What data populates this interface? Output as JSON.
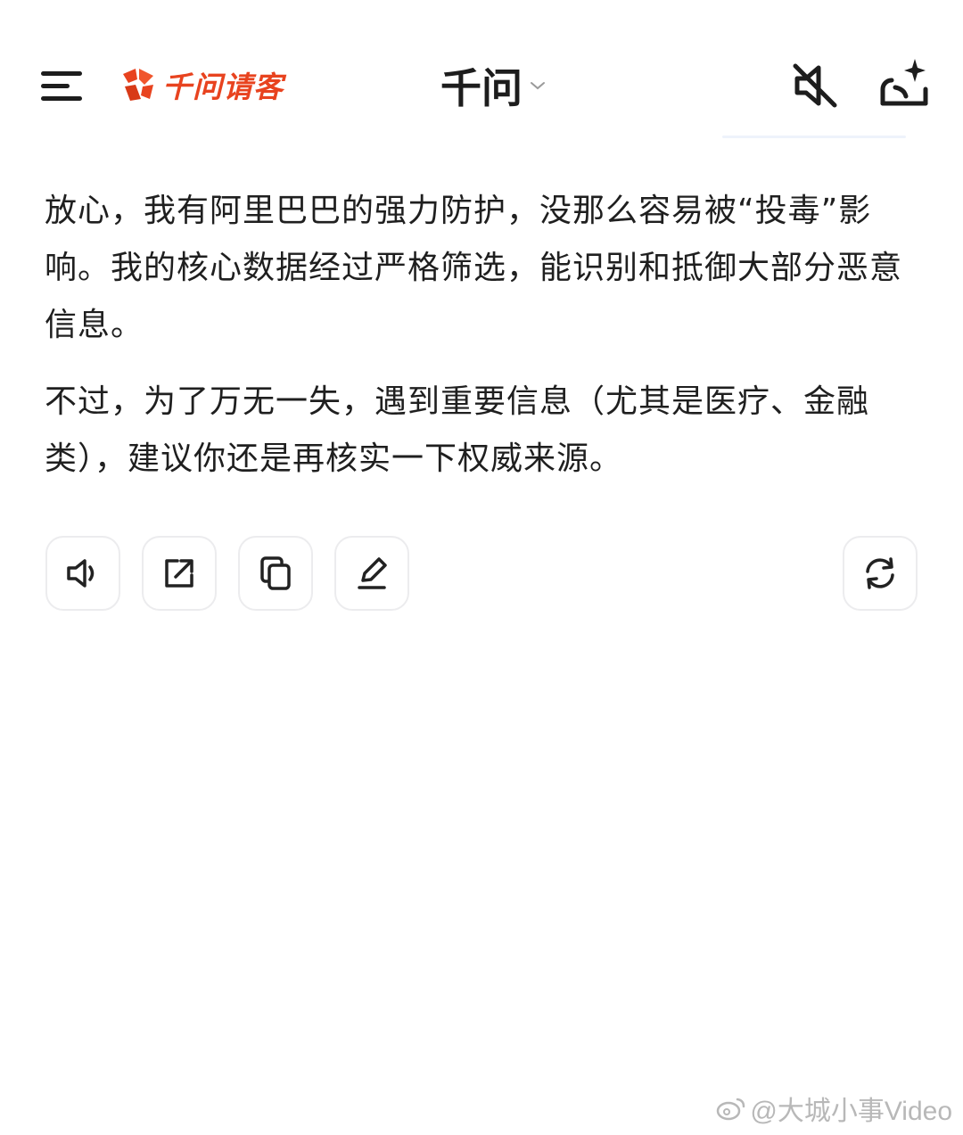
{
  "header": {
    "brand_text": "千问请客",
    "model_title": "千问"
  },
  "message": {
    "paragraphs": [
      "放心，我有阿里巴巴的强力防护，没那么容易被“投毒”影响。我的核心数据经过严格筛选，能识别和抵御大部分恶意信息。",
      "不过，为了万无一失，遇到重要信息（尤其是医疗、金融类），建议你还是再核实一下权威来源。"
    ]
  },
  "actions": [
    {
      "icon": "speaker-icon"
    },
    {
      "icon": "share-icon"
    },
    {
      "icon": "copy-icon"
    },
    {
      "icon": "edit-icon"
    },
    {
      "icon": "refresh-icon"
    }
  ],
  "colors": {
    "brand": "#e8431f",
    "text": "#1f1f1f",
    "border": "#ececee"
  },
  "watermark": {
    "text": "@大城小事Video"
  }
}
